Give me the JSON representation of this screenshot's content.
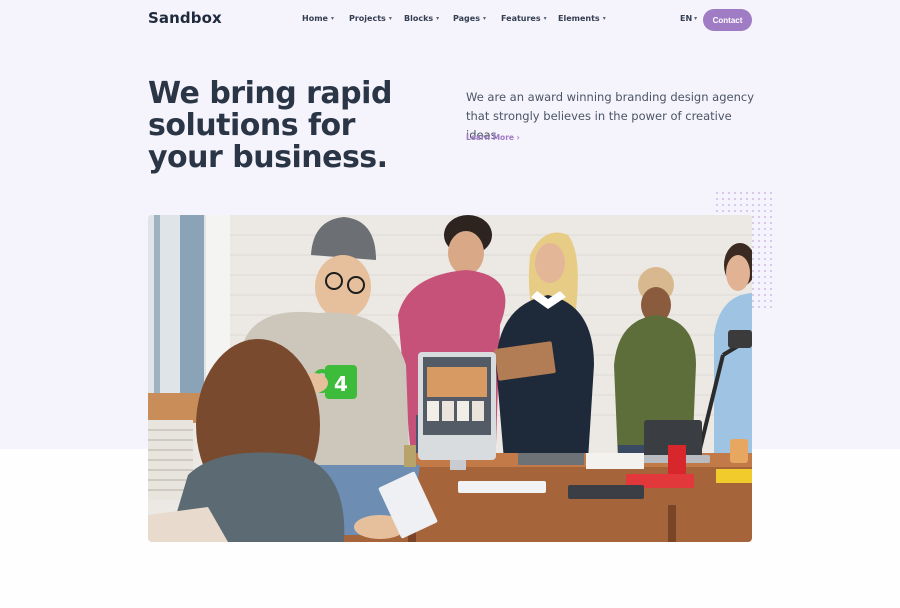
{
  "brand": {
    "name": "Sandbox"
  },
  "nav": {
    "items": [
      {
        "label": "Home"
      },
      {
        "label": "Projects"
      },
      {
        "label": "Blocks"
      },
      {
        "label": "Pages"
      },
      {
        "label": "Features"
      },
      {
        "label": "Elements"
      }
    ],
    "language": "EN",
    "contact_label": "Contact"
  },
  "hero": {
    "title": "We bring rapid solutions for your business.",
    "description": "We are an award winning branding design agency that strongly believes in the power of creative ideas.",
    "learn_more": "Learn More ›"
  },
  "photo": {
    "mug_number": "4"
  },
  "colors": {
    "accent": "#a07cc5",
    "heading": "#2a3546",
    "hero_bg": "#f5f3fc"
  },
  "icons": {
    "dropdown": "chevron-down-icon"
  }
}
